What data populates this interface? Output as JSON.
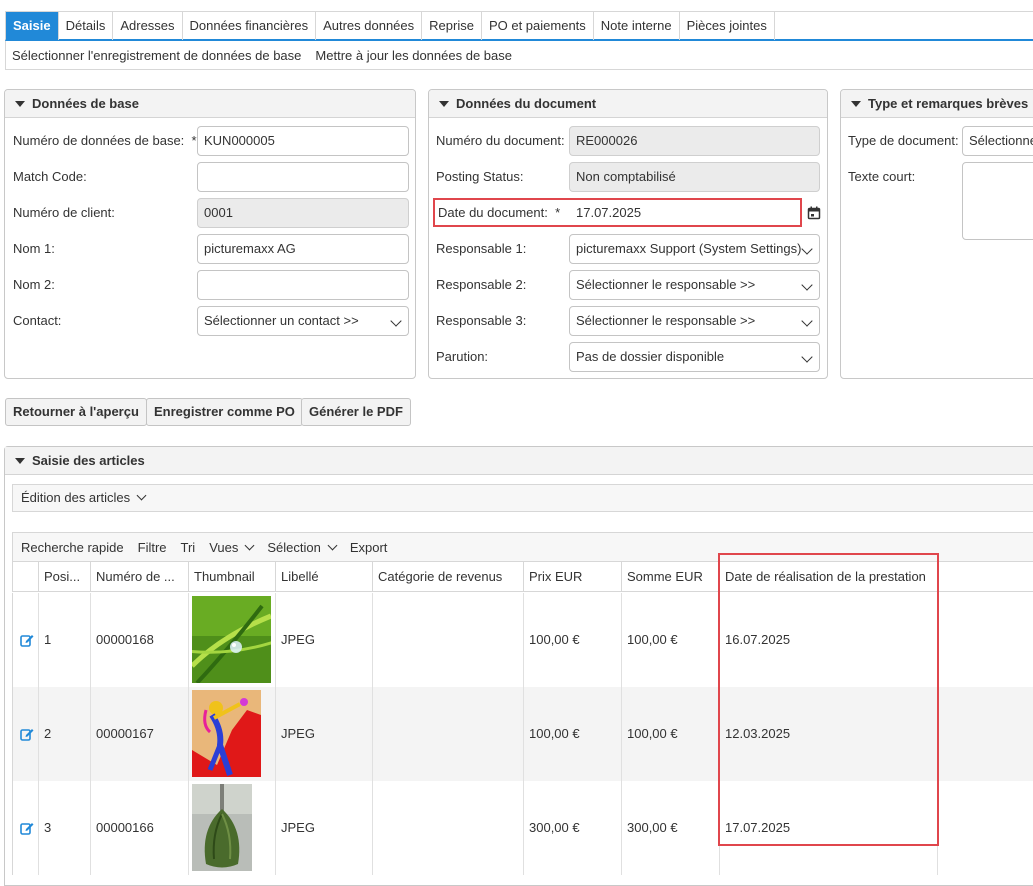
{
  "tabs": [
    "Saisie",
    "Détails",
    "Adresses",
    "Données financières",
    "Autres données",
    "Reprise",
    "PO et paiements",
    "Note interne",
    "Pièces jointes"
  ],
  "subnav": [
    "Sélectionner l'enregistrement de données de base",
    "Mettre à jour les données de base"
  ],
  "base": {
    "title": "Données de base",
    "number_label": "Numéro de données de base:",
    "required_mark": "*",
    "number_value": "KUN000005",
    "match_label": "Match Code:",
    "match_value": "",
    "client_label": "Numéro de client:",
    "client_value": "0001",
    "name1_label": "Nom 1:",
    "name1_value": "picturemaxx AG",
    "name2_label": "Nom 2:",
    "name2_value": "",
    "contact_label": "Contact:",
    "contact_value": "Sélectionner un contact >>"
  },
  "doc": {
    "title": "Données du document",
    "number_label": "Numéro du document:",
    "number_value": "RE000026",
    "status_label": "Posting Status:",
    "status_value": "Non comptabilisé",
    "date_label": "Date du document:",
    "required_mark": "*",
    "date_value": "17.07.2025",
    "resp1_label": "Responsable 1:",
    "resp1_value": "picturemaxx Support (System Settings)",
    "resp2_label": "Responsable 2:",
    "resp2_value": "Sélectionner le responsable >>",
    "resp3_label": "Responsable 3:",
    "resp3_value": "Sélectionner le responsable >>",
    "parution_label": "Parution:",
    "parution_value": "Pas de dossier disponible"
  },
  "type": {
    "title": "Type et remarques brèves",
    "doctype_label": "Type de document:",
    "doctype_value": "Sélectionner",
    "short_label": "Texte court:"
  },
  "buttons": {
    "back": "Retourner à l'aperçu",
    "save_po": "Enregistrer comme PO",
    "pdf": "Générer le PDF"
  },
  "articles": {
    "title": "Saisie des articles",
    "edition": "Édition des articles",
    "toolbar": {
      "quick_search": "Recherche rapide",
      "filter": "Filtre",
      "sort": "Tri",
      "views": "Vues",
      "selection": "Sélection",
      "export": "Export"
    },
    "columns": [
      "Posi...",
      "Numéro de ...",
      "Thumbnail",
      "Libellé",
      "Catégorie de revenus",
      "Prix EUR",
      "Somme EUR",
      "Date de réalisation de la prestation"
    ],
    "rows": [
      {
        "pos": "1",
        "num": "00000168",
        "label": "JPEG",
        "category": "",
        "price": "100,00 €",
        "sum": "100,00 €",
        "date": "16.07.2025"
      },
      {
        "pos": "2",
        "num": "00000167",
        "label": "JPEG",
        "category": "",
        "price": "100,00 €",
        "sum": "100,00 €",
        "date": "12.03.2025"
      },
      {
        "pos": "3",
        "num": "00000166",
        "label": "JPEG",
        "category": "",
        "price": "300,00 €",
        "sum": "300,00 €",
        "date": "17.07.2025"
      }
    ]
  },
  "colors": {
    "accent": "#2189d8",
    "highlight": "#e0464c"
  }
}
